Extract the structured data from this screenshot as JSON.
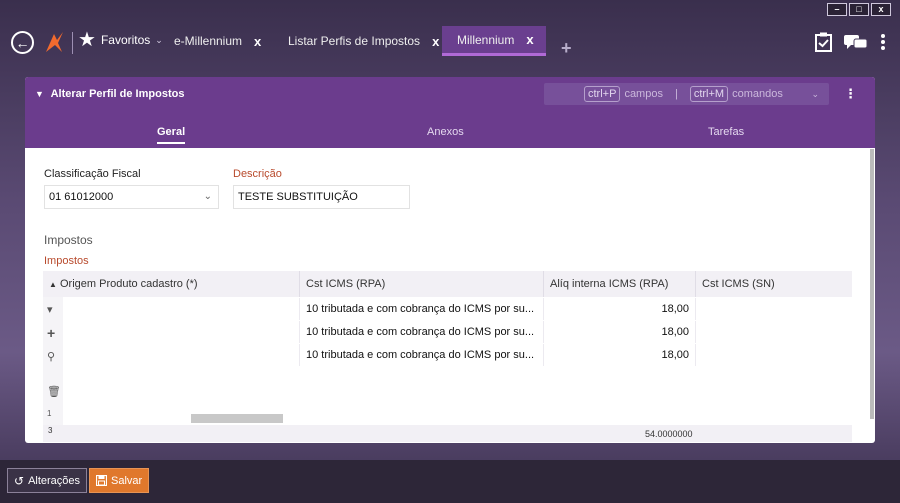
{
  "window_controls": {
    "minimize": "–",
    "maximize": "□",
    "close": "x"
  },
  "topbar": {
    "favorites_label": "Favoritos",
    "tabs": [
      {
        "label": "e-Millennium",
        "close": "x"
      },
      {
        "label": "Listar Perfis de Impostos",
        "close": "x"
      },
      {
        "label": "Millennium",
        "close": "x"
      }
    ],
    "add_tab": "+"
  },
  "panel": {
    "title": "Alterar Perfil de Impostos",
    "shortcut_campos_key": "ctrl+P",
    "shortcut_campos_label": "campos",
    "separator": "|",
    "shortcut_comandos_key": "ctrl+M",
    "shortcut_comandos_label": "comandos",
    "tabs": [
      "Geral",
      "Anexos",
      "Tarefas"
    ]
  },
  "form": {
    "classificacao_label": "Classificação Fiscal",
    "classificacao_value": "01 61012000",
    "descricao_label": "Descrição",
    "descricao_value": "TESTE SUBSTITUIÇÃO"
  },
  "section": {
    "title": "Impostos",
    "grid_label": "Impostos"
  },
  "grid": {
    "columns": [
      "Origem Produto cadastro (*)",
      "Cst ICMS (RPA)",
      "Alíq interna ICMS (RPA)",
      "Cst ICMS (SN)"
    ],
    "rows": [
      [
        "",
        "10 tributada e com cobrança do ICMS por su...",
        "18,00",
        ""
      ],
      [
        "",
        "10 tributada e com cobrança do ICMS por su...",
        "18,00",
        ""
      ],
      [
        "",
        "10 tributada e com cobrança do ICMS por su...",
        "18,00",
        ""
      ]
    ],
    "row_num_top": "1",
    "row_num_bottom": "3",
    "footer_total": "54.0000000"
  },
  "bottom": {
    "alteracoes_label": "Alterações",
    "salvar_label": "Salvar"
  },
  "colors": {
    "accent": "#6b3c8d",
    "tab_active": "#b06ad6",
    "save": "#e0782c",
    "required_label": "#b84a2c"
  }
}
